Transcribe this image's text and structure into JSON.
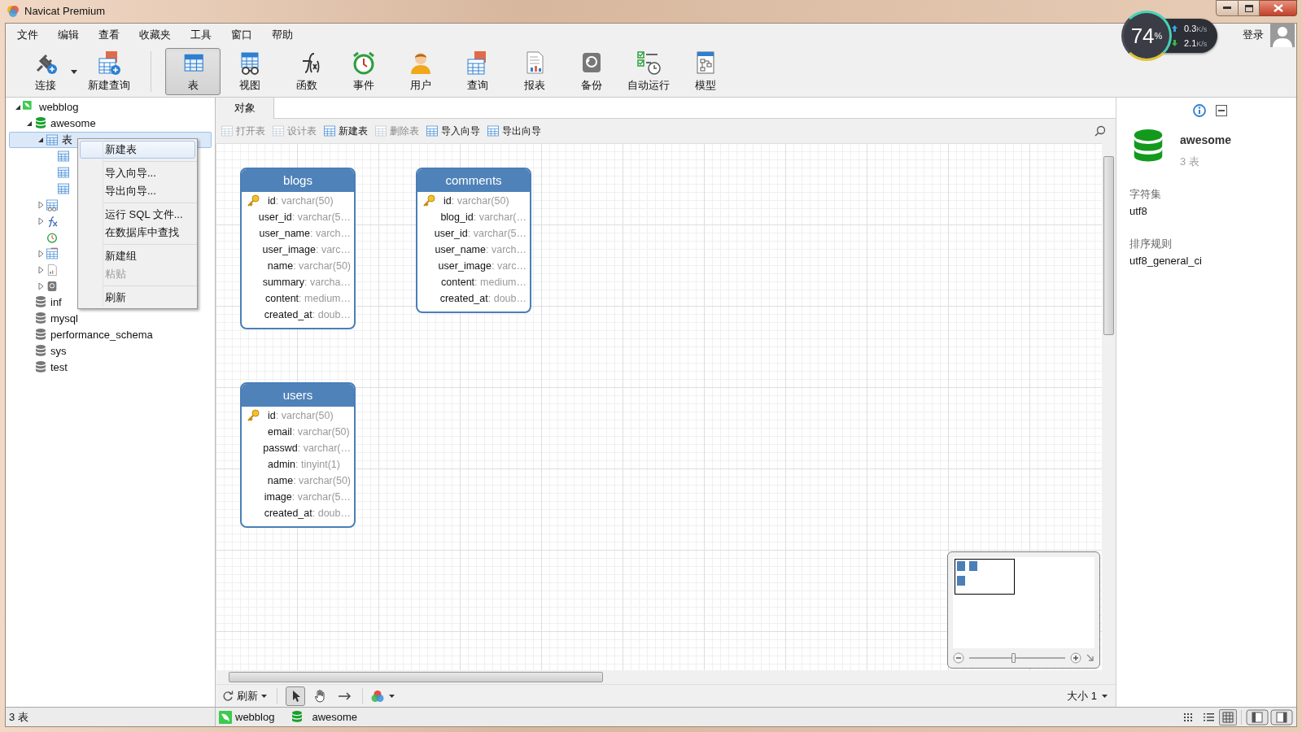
{
  "window": {
    "title": "Navicat Premium"
  },
  "menu_bar": [
    "文件",
    "编辑",
    "查看",
    "收藏夹",
    "工具",
    "窗口",
    "帮助"
  ],
  "toolbar": [
    {
      "label": "连接",
      "selected": false,
      "dropdown": true
    },
    {
      "label": "新建查询",
      "selected": false,
      "dropdown": false
    },
    {
      "label": "表",
      "selected": true,
      "dropdown": false
    },
    {
      "label": "视图",
      "selected": false,
      "dropdown": false
    },
    {
      "label": "函数",
      "selected": false,
      "dropdown": false
    },
    {
      "label": "事件",
      "selected": false,
      "dropdown": false
    },
    {
      "label": "用户",
      "selected": false,
      "dropdown": false
    },
    {
      "label": "查询",
      "selected": false,
      "dropdown": false
    },
    {
      "label": "报表",
      "selected": false,
      "dropdown": false
    },
    {
      "label": "备份",
      "selected": false,
      "dropdown": false
    },
    {
      "label": "自动运行",
      "selected": false,
      "dropdown": false
    },
    {
      "label": "模型",
      "selected": false,
      "dropdown": false
    }
  ],
  "network_widget": {
    "percent": "74",
    "percent_sign": "%",
    "upload": {
      "value": "0.3",
      "unit": "K/s"
    },
    "download": {
      "value": "2.1",
      "unit": "K/s"
    }
  },
  "login": {
    "label": "登录"
  },
  "tree": [
    {
      "kind": "connection",
      "label": "webblog",
      "expanded": true,
      "selected": false,
      "children": [
        {
          "kind": "database",
          "label": "awesome",
          "open": true,
          "expanded": true,
          "selected": false,
          "children": [
            {
              "kind": "tables",
              "label": "表",
              "expanded": true,
              "selected": true,
              "children": [
                {
                  "kind": "table",
                  "selected": false
                },
                {
                  "kind": "table",
                  "selected": false
                },
                {
                  "kind": "table",
                  "selected": false
                }
              ]
            },
            {
              "kind": "views",
              "expanded": false,
              "selected": false
            },
            {
              "kind": "functions",
              "expanded": false,
              "selected": false
            },
            {
              "kind": "events",
              "selected": false
            },
            {
              "kind": "queries",
              "expanded": false,
              "selected": false
            },
            {
              "kind": "reports",
              "expanded": false,
              "selected": false
            },
            {
              "kind": "backups",
              "expanded": false,
              "selected": false
            }
          ]
        },
        {
          "kind": "database",
          "label": "inf",
          "open": false,
          "selected": false
        },
        {
          "kind": "database",
          "label": "mysql",
          "open": false,
          "selected": false
        },
        {
          "kind": "database",
          "label": "performance_schema",
          "open": false,
          "selected": false
        },
        {
          "kind": "database",
          "label": "sys",
          "open": false,
          "selected": false
        },
        {
          "kind": "database",
          "label": "test",
          "open": false,
          "selected": false
        }
      ]
    }
  ],
  "context_menu": [
    [
      {
        "label": "新建表",
        "selected": true,
        "disabled": false
      }
    ],
    [
      {
        "label": "导入向导...",
        "selected": false,
        "disabled": false
      },
      {
        "label": "导出向导...",
        "selected": false,
        "disabled": false
      }
    ],
    [
      {
        "label": "运行 SQL 文件...",
        "selected": false,
        "disabled": false
      },
      {
        "label": "在数据库中查找",
        "selected": false,
        "disabled": false
      }
    ],
    [
      {
        "label": "新建组",
        "selected": false,
        "disabled": false
      },
      {
        "label": "粘贴",
        "selected": false,
        "disabled": true
      }
    ],
    [
      {
        "label": "刷新",
        "selected": false,
        "disabled": false
      }
    ]
  ],
  "tabs": [
    {
      "label": "对象",
      "selected": true
    }
  ],
  "object_toolbar": [
    {
      "label": "打开表",
      "disabled": true
    },
    {
      "label": "设计表",
      "disabled": true
    },
    {
      "label": "新建表",
      "disabled": false
    },
    {
      "label": "删除表",
      "disabled": true
    },
    {
      "label": "导入向导",
      "disabled": false
    },
    {
      "label": "导出向导",
      "disabled": false
    }
  ],
  "er_tables": [
    {
      "name": "blogs",
      "fields": [
        {
          "name": "id",
          "type": ": varchar(50)",
          "primary_key": true
        },
        {
          "name": "user_id",
          "type": ": varchar(5…",
          "primary_key": false
        },
        {
          "name": "user_name",
          "type": ": varch…",
          "primary_key": false
        },
        {
          "name": "user_image",
          "type": ": varc…",
          "primary_key": false
        },
        {
          "name": "name",
          "type": ": varchar(50)",
          "primary_key": false
        },
        {
          "name": "summary",
          "type": ": varcha…",
          "primary_key": false
        },
        {
          "name": "content",
          "type": ": medium…",
          "primary_key": false
        },
        {
          "name": "created_at",
          "type": ": doub…",
          "primary_key": false
        }
      ]
    },
    {
      "name": "comments",
      "fields": [
        {
          "name": "id",
          "type": ": varchar(50)",
          "primary_key": true
        },
        {
          "name": "blog_id",
          "type": ": varchar(…",
          "primary_key": false
        },
        {
          "name": "user_id",
          "type": ": varchar(5…",
          "primary_key": false
        },
        {
          "name": "user_name",
          "type": ": varch…",
          "primary_key": false
        },
        {
          "name": "user_image",
          "type": ": varc…",
          "primary_key": false
        },
        {
          "name": "content",
          "type": ": medium…",
          "primary_key": false
        },
        {
          "name": "created_at",
          "type": ": doub…",
          "primary_key": false
        }
      ]
    },
    {
      "name": "users",
      "fields": [
        {
          "name": "id",
          "type": ": varchar(50)",
          "primary_key": true
        },
        {
          "name": "email",
          "type": ": varchar(50)",
          "primary_key": false
        },
        {
          "name": "passwd",
          "type": ": varchar(…",
          "primary_key": false
        },
        {
          "name": "admin",
          "type": ": tinyint(1)",
          "primary_key": false
        },
        {
          "name": "name",
          "type": ": varchar(50)",
          "primary_key": false
        },
        {
          "name": "image",
          "type": ": varchar(5…",
          "primary_key": false
        },
        {
          "name": "created_at",
          "type": ": doub…",
          "primary_key": false
        }
      ]
    }
  ],
  "minimap": {
    "zoom": {
      "level": 0.47
    }
  },
  "canvas_toolbar": {
    "refresh": "刷新",
    "tools": [
      {
        "kind": "pointer",
        "selected": true
      },
      {
        "kind": "hand",
        "selected": false
      },
      {
        "kind": "connector",
        "selected": false
      }
    ],
    "size": "大小 1"
  },
  "info_panel": {
    "name": "awesome",
    "subtitle": "3 表",
    "properties": [
      {
        "label": "字符集",
        "value": "utf8"
      },
      {
        "label": "排序规则",
        "value": "utf8_general_ci"
      }
    ]
  },
  "status_bar": {
    "left": "3 表",
    "crumbs": [
      {
        "kind": "connection",
        "label": "webblog"
      },
      {
        "kind": "database",
        "label": "awesome"
      }
    ],
    "view_modes": [
      {
        "kind": "icons",
        "selected": false
      },
      {
        "kind": "list",
        "selected": false
      },
      {
        "kind": "detail",
        "selected": true
      }
    ]
  }
}
